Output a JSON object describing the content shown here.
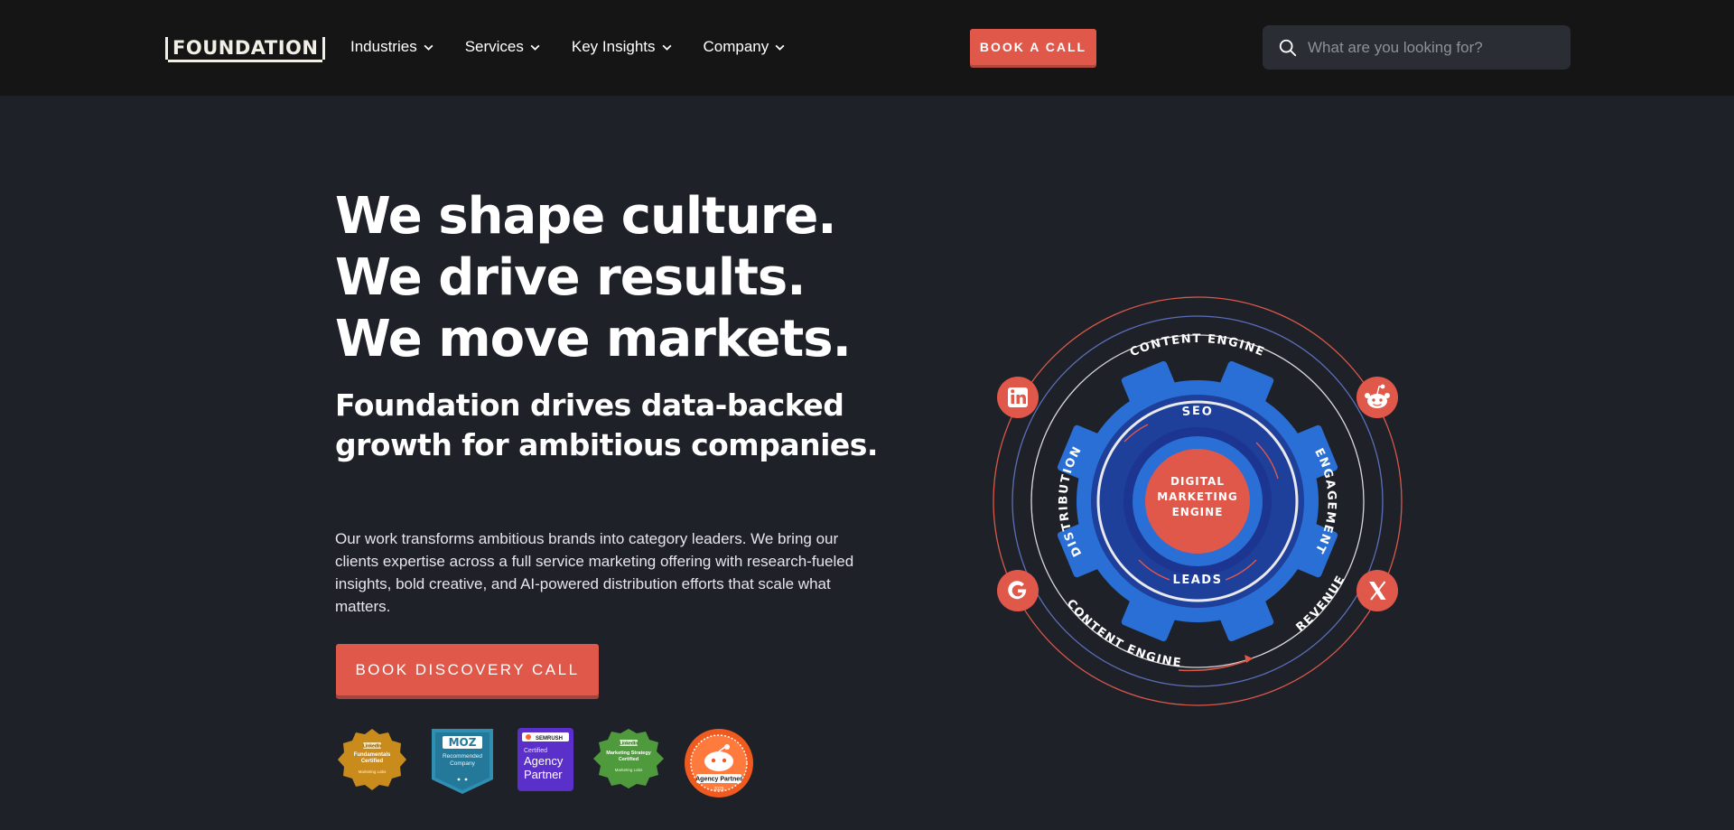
{
  "nav": {
    "logo": "FOUNDATION",
    "menu": [
      "Industries",
      "Services",
      "Key Insights",
      "Company"
    ],
    "book_call": "BOOK A CALL",
    "search_placeholder": "What are you looking for?"
  },
  "hero": {
    "headline": [
      "We shape culture.",
      "We drive results.",
      "We move markets."
    ],
    "subhead": [
      "Foundation drives data-backed",
      "growth for ambitious companies."
    ],
    "body": "Our work transforms ambitious brands into category leaders. We bring our clients expertise across a full service marketing offering with research-fueled insights, bold creative, and AI-powered distribution efforts that scale what matters.",
    "cta": "BOOK DISCOVERY CALL"
  },
  "badges": {
    "linkedin_fund": [
      "LinkedIn",
      "Fundamentals",
      "Certified",
      "Marketing Labs"
    ],
    "moz": [
      "MOZ",
      "Recommended",
      "Company"
    ],
    "semrush": [
      "SEMRUSH",
      "Certified",
      "Agency",
      "Partner"
    ],
    "linkedin_strategy": [
      "LinkedIn",
      "Marketing Strategy",
      "Certified",
      "Marketing Labs"
    ],
    "reddit": [
      "Agency Partner",
      "2025"
    ]
  },
  "diagram": {
    "outer_top": "CONTENT ENGINE",
    "outer_bottom": "CONTENT ENGINE",
    "revenue": "REVENUE",
    "seo": "SEO",
    "engagement": "ENGAGEMENT",
    "leads": "LEADS",
    "distribution": "DISTRIBUTION",
    "center": [
      "DIGITAL",
      "MARKETING",
      "ENGINE"
    ],
    "icons": [
      "linkedin-icon",
      "reddit-icon",
      "google-icon",
      "x-icon"
    ]
  },
  "colors": {
    "accent": "#e0584a",
    "gear": "#2a6fd6",
    "gear_inner": "#1a3a8c",
    "nav_bg": "#151515",
    "page_bg": "#1f2129"
  }
}
